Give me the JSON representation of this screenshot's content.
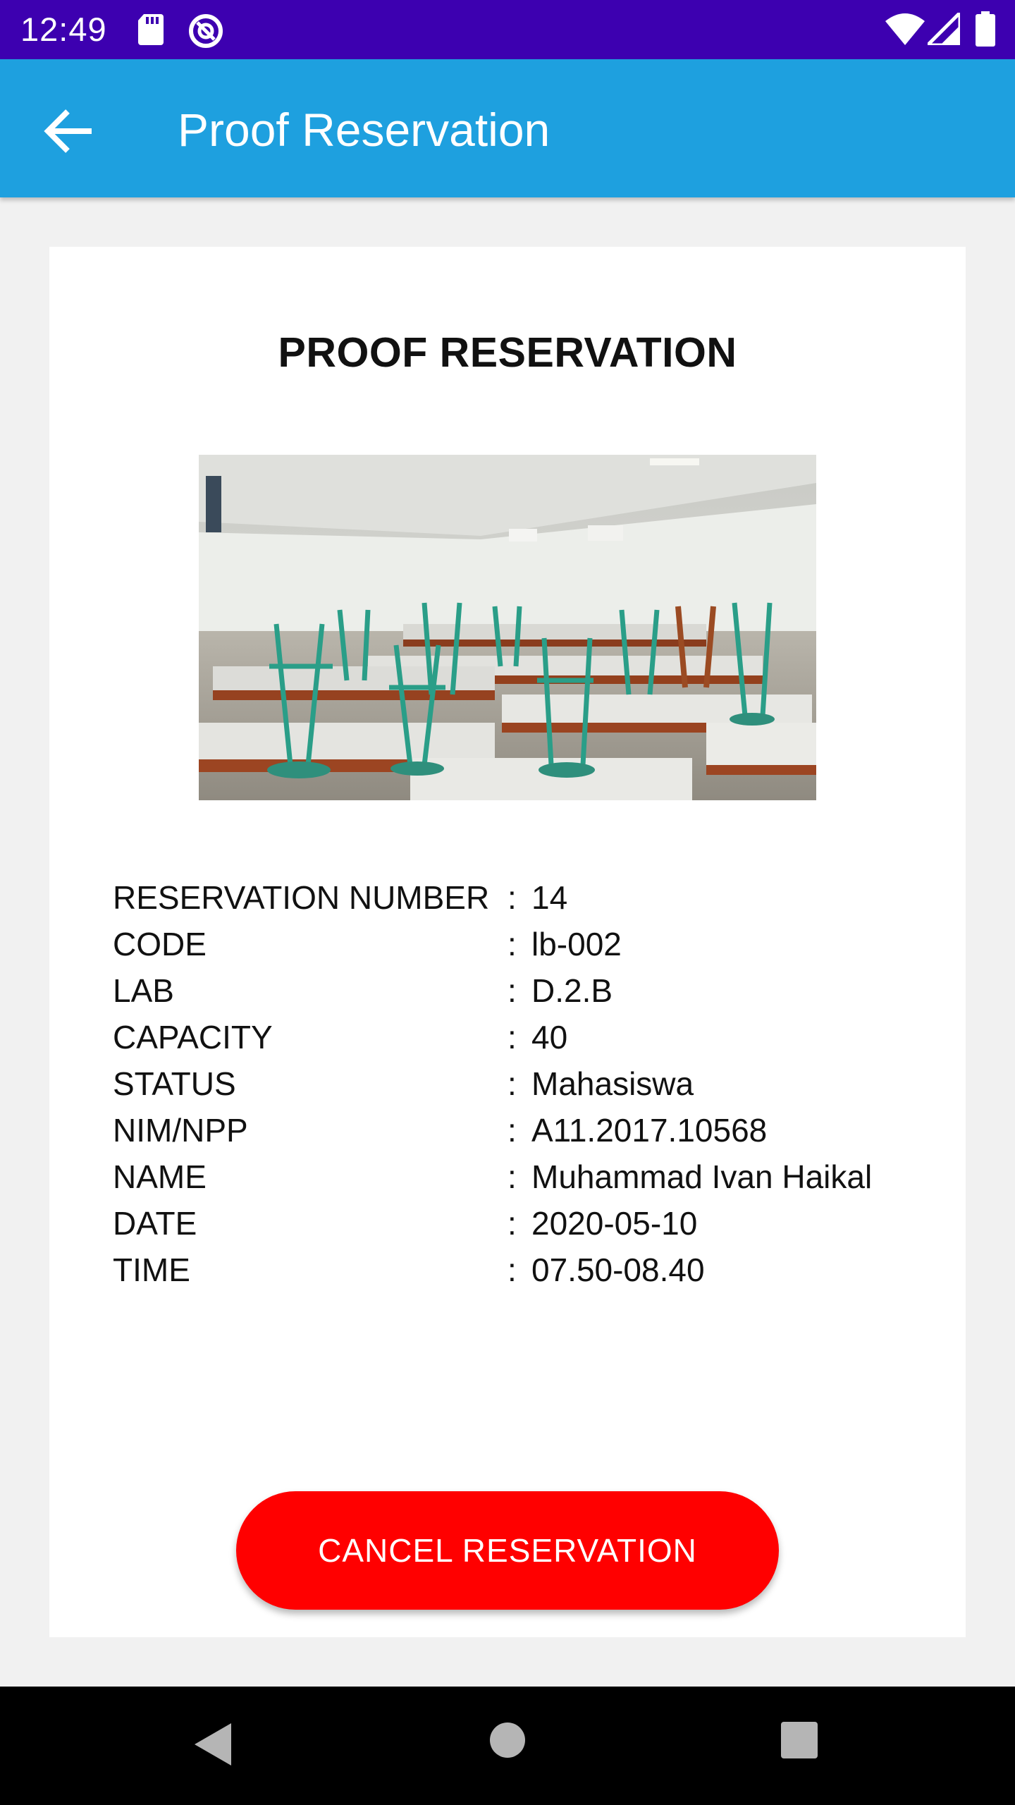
{
  "status_bar": {
    "time": "12:49",
    "left_icons": [
      "sd-card-icon",
      "sync-icon"
    ],
    "right_icons": [
      "wifi-icon",
      "signal-icon",
      "battery-icon"
    ],
    "color": "#3d00b0"
  },
  "app_bar": {
    "title": "Proof Reservation",
    "back_icon": "arrow-back-icon",
    "color": "#1ea0df"
  },
  "card": {
    "heading": "PROOF RESERVATION",
    "fields": [
      {
        "label": "RESERVATION NUMBER",
        "separator": ":",
        "value": "14"
      },
      {
        "label": "CODE",
        "separator": ":",
        "value": "lb-002"
      },
      {
        "label": "LAB",
        "separator": ":",
        "value": "D.2.B"
      },
      {
        "label": "CAPACITY",
        "separator": ":",
        "value": "40"
      },
      {
        "label": "STATUS",
        "separator": ":",
        "value": "Mahasiswa"
      },
      {
        "label": "NIM/NPP",
        "separator": ":",
        "value": "A11.2017.10568"
      },
      {
        "label": "NAME",
        "separator": ":",
        "value": "Muhammad Ivan Haikal"
      },
      {
        "label": "DATE",
        "separator": ":",
        "value": "2020-05-10"
      },
      {
        "label": "TIME",
        "separator": ":",
        "value": "07.50-08.40"
      }
    ],
    "cancel_button": "CANCEL RESERVATION",
    "cancel_color": "#ff0000"
  },
  "nav_bar": {
    "icons": [
      "nav-back-icon",
      "nav-home-icon",
      "nav-recents-icon"
    ]
  }
}
